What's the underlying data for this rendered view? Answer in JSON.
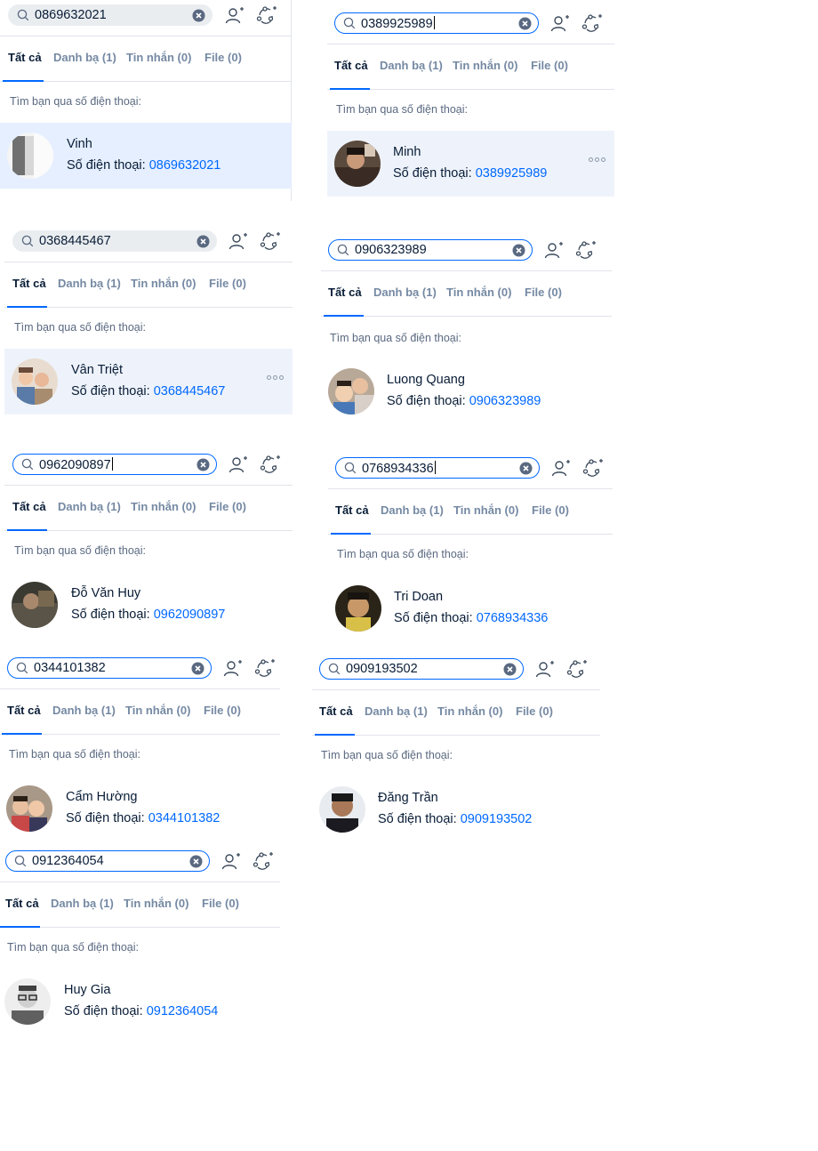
{
  "common": {
    "tabs": [
      "Tất cả",
      "Danh bạ (1)",
      "Tin nhắn (0)",
      "File (0)"
    ],
    "hint": "Tìm bạn qua số điện thoại:",
    "phone_label": "Số điện thoại: "
  },
  "panels": [
    {
      "query": "0869632021",
      "name": "Vinh",
      "phone": "0869632021"
    },
    {
      "query": "0389925989",
      "name": "Minh",
      "phone": "0389925989"
    },
    {
      "query": "0368445467",
      "name": "Vân Triệt",
      "phone": "0368445467"
    },
    {
      "query": "0906323989",
      "name": "Luong Quang",
      "phone": "0906323989"
    },
    {
      "query": "0962090897",
      "name": "Đỗ Văn Huy",
      "phone": "0962090897"
    },
    {
      "query": "0768934336",
      "name": "Tri Doan",
      "phone": "0768934336"
    },
    {
      "query": "0344101382",
      "name": "Cẩm Hường",
      "phone": "0344101382"
    },
    {
      "query": "0909193502",
      "name": "Đăng Trần",
      "phone": "0909193502"
    },
    {
      "query": "0912364054",
      "name": "Huy Gia",
      "phone": "0912364054"
    }
  ],
  "colors": {
    "accent": "#0068ff",
    "link": "#0068ff",
    "highlight": "#e5efff"
  }
}
